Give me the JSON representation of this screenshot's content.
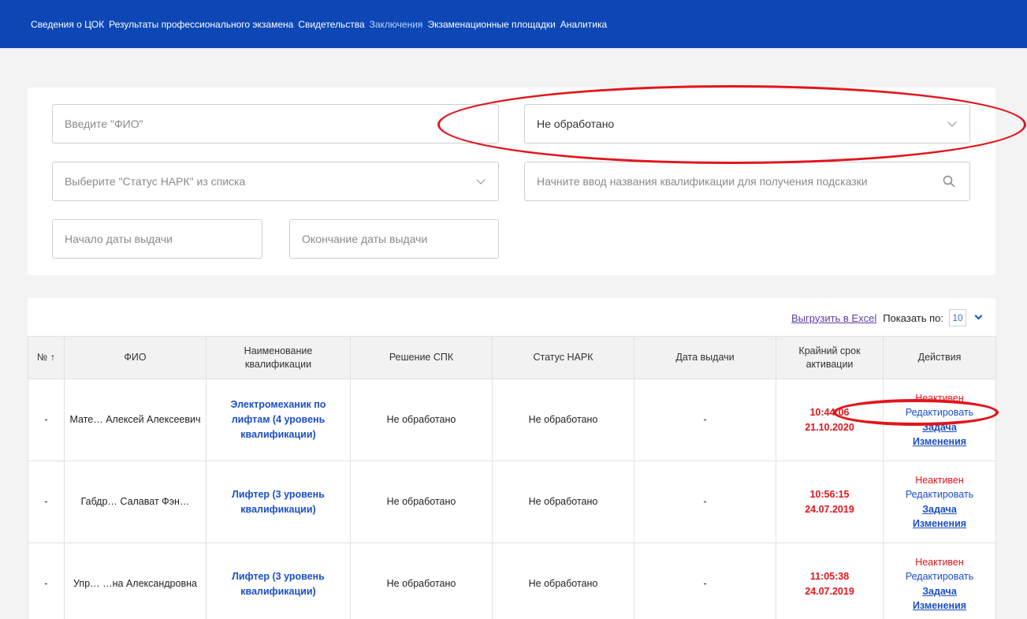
{
  "nav": {
    "items": [
      "Сведения о ЦОК",
      "Результаты профессионального экзамена",
      "Свидетельства",
      "Заключения",
      "Экзаменационные площадки",
      "Аналитика"
    ]
  },
  "filters": {
    "fio_placeholder": "Введите \"ФИО\"",
    "status_value": "Не обработано",
    "nark_placeholder": "Выберите \"Статус НАРК\" из списка",
    "qual_placeholder": "Начните ввод названия квалификации для получения подсказки",
    "date_from_placeholder": "Начало даты выдачи",
    "date_to_placeholder": "Окончание даты выдачи"
  },
  "results": {
    "export_label": "Выгрузить в Excel",
    "page_size_label": "Показать по:",
    "page_size_value": "10",
    "columns": [
      "№ ↑",
      "ФИО",
      "Наименование квалификации",
      "Решение СПК",
      "Статус НАРК",
      "Дата выдачи",
      "Крайний срок активации",
      "Действия"
    ],
    "rows": [
      {
        "num": "-",
        "fio": "Мате… Алексей Алексеевич",
        "qualification": "Электромеханик по лифтам (4 уровень квалификации)",
        "spk": "Не обработано",
        "nark": "Не обработано",
        "issued": "-",
        "deadline_time": "10:44:06",
        "deadline_date": "21.10.2020",
        "status": "Неактивен",
        "edit": "Редактировать",
        "task": "Задача",
        "changes": "Изменения"
      },
      {
        "num": "-",
        "fio": "Габдр… Салават Фэн…",
        "qualification": "Лифтер (3 уровень квалификации)",
        "spk": "Не обработано",
        "nark": "Не обработано",
        "issued": "-",
        "deadline_time": "10:56:15",
        "deadline_date": "24.07.2019",
        "status": "Неактивен",
        "edit": "Редактировать",
        "task": "Задача",
        "changes": "Изменения"
      },
      {
        "num": "-",
        "fio": "Упр… …на Александровна",
        "qualification": "Лифтер (3 уровень квалификации)",
        "spk": "Не обработано",
        "nark": "Не обработано",
        "issued": "-",
        "deadline_time": "11:05:38",
        "deadline_date": "24.07.2019",
        "status": "Неактивен",
        "edit": "Редактировать",
        "task": "Задача",
        "changes": "Изменения"
      }
    ]
  },
  "colors": {
    "nav_bg": "#0d47b5",
    "link_blue": "#1b4fc7",
    "alert_red": "#e3141b",
    "annotation_red": "#e3141b"
  }
}
